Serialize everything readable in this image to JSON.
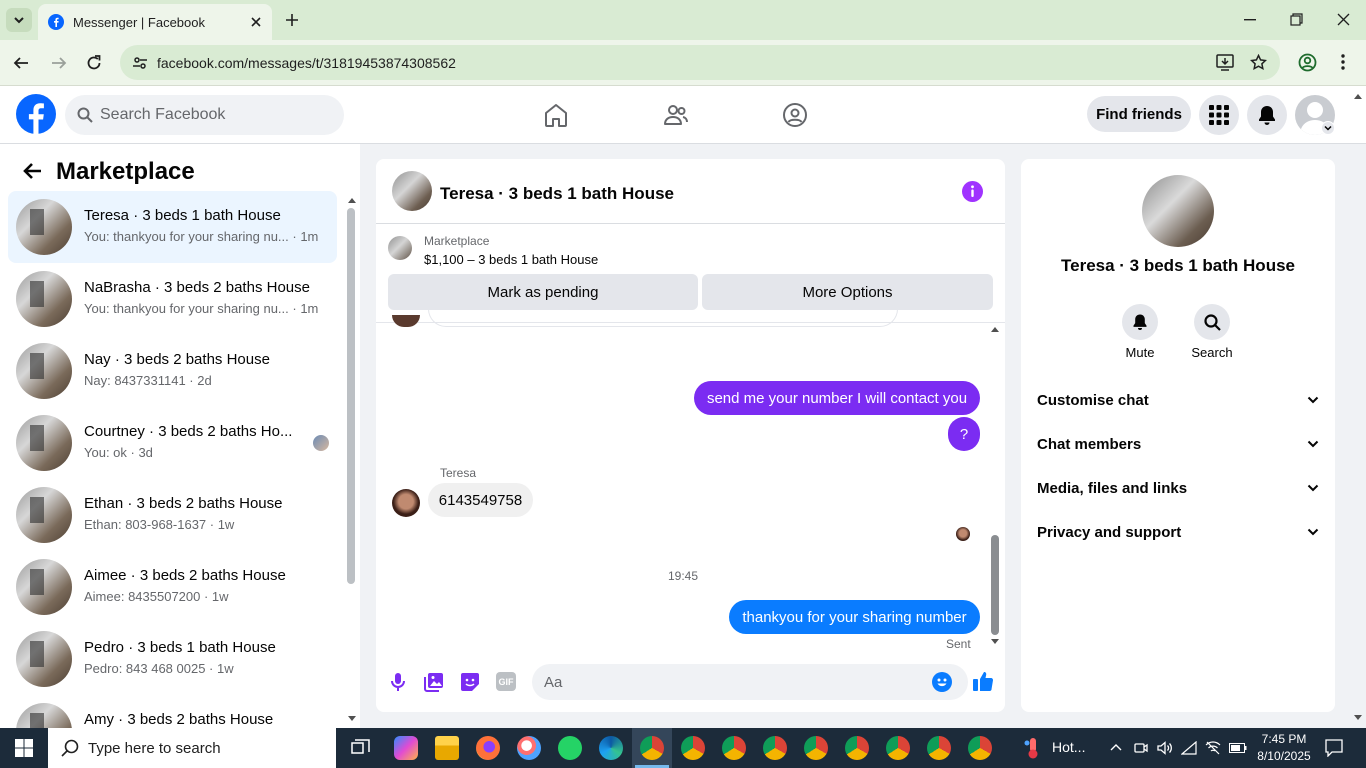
{
  "browser": {
    "tab_title": "Messenger | Facebook",
    "url": "facebook.com/messages/t/31819453874308562"
  },
  "fb_header": {
    "search_placeholder": "Search Facebook",
    "find_friends": "Find friends"
  },
  "left": {
    "title": "Marketplace",
    "conversations": [
      {
        "title": "Teresa · 3 beds 1 bath House",
        "sub": "You: thankyou for your sharing nu... · 1m"
      },
      {
        "title": "NaBrasha · 3 beds 2 baths House",
        "sub": "You: thankyou for your sharing nu... · 1m"
      },
      {
        "title": "Nay · 3 beds 2 baths House",
        "sub": "Nay: 8437331141 · 2d"
      },
      {
        "title": "Courtney · 3 beds 2 baths Ho...",
        "sub": "You: ok · 3d"
      },
      {
        "title": "Ethan · 3 beds 2 baths House",
        "sub": "Ethan: 803-968-1637 · 1w"
      },
      {
        "title": "Aimee · 3 beds 2 baths House",
        "sub": "Aimee: 8435507200 · 1w"
      },
      {
        "title": "Pedro · 3 beds 1 bath House",
        "sub": "Pedro: 843 468 0025 · 1w"
      },
      {
        "title": "Amy · 3 beds 2 baths House",
        "sub": ""
      }
    ]
  },
  "chat": {
    "name": "Teresa · 3 beds 1 bath House",
    "marketplace_label": "Marketplace",
    "listing": "$1,100 – 3 beds 1 bath House",
    "mark_pending": "Mark as pending",
    "more_options": "More Options",
    "messages": {
      "out1": "send me your number I will contact you",
      "out2": "?",
      "sender": "Teresa",
      "in1": "6143549758",
      "time": "19:45",
      "out3": "thankyou for your sharing number",
      "status": "Sent"
    },
    "composer_placeholder": "Aa",
    "gif_label": "GIF"
  },
  "right": {
    "name": "Teresa · 3 beds 1 bath House",
    "mute": "Mute",
    "search": "Search",
    "rows": [
      "Customise chat",
      "Chat members",
      "Media, files and links",
      "Privacy and support"
    ]
  },
  "taskbar": {
    "search_placeholder": "Type here to search",
    "weather": "Hot...",
    "time": "7:45 PM",
    "date": "8/10/2025"
  },
  "colors": {
    "fb_blue": "#0866ff",
    "messenger_purple": "#7b2cf2",
    "bubble_blue": "#0a7cff"
  }
}
